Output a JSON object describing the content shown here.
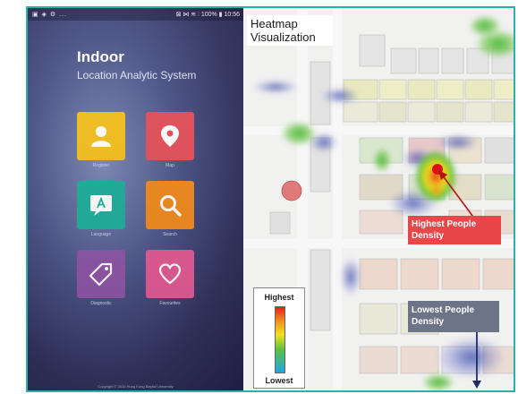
{
  "phone": {
    "status_bar": {
      "left": "▣ ◈ ⚙ ...",
      "right": "⊠ ⋈ ≋ ⫶ 100% ▮ 10:56"
    },
    "title": "Indoor",
    "subtitle": "Location Analytic System",
    "tiles": [
      {
        "label": "Register",
        "icon": "person-icon",
        "color": "#f4c020"
      },
      {
        "label": "Map",
        "icon": "map-pin-icon",
        "color": "#e3505a"
      },
      {
        "label": "Language",
        "icon": "language-icon",
        "color": "#1fae9b"
      },
      {
        "label": "Search",
        "icon": "search-icon",
        "color": "#f08a1e"
      },
      {
        "label": "Diagnostic",
        "icon": "tag-icon",
        "color": "#8e55a6"
      },
      {
        "label": "Favourites",
        "icon": "heart-icon",
        "color": "#e15a95"
      }
    ],
    "footer": "Copyright © 2016 Hong Kong Baptist University"
  },
  "heatmap": {
    "title": "Heatmap Visualization",
    "callout_high": "Highest People Density",
    "callout_low": "Lowest People Density",
    "legend": {
      "highest": "Highest",
      "lowest": "Lowest"
    }
  },
  "colors": {
    "frame": "#27b3a5",
    "high": "#e8474a",
    "low": "#6d7487"
  }
}
